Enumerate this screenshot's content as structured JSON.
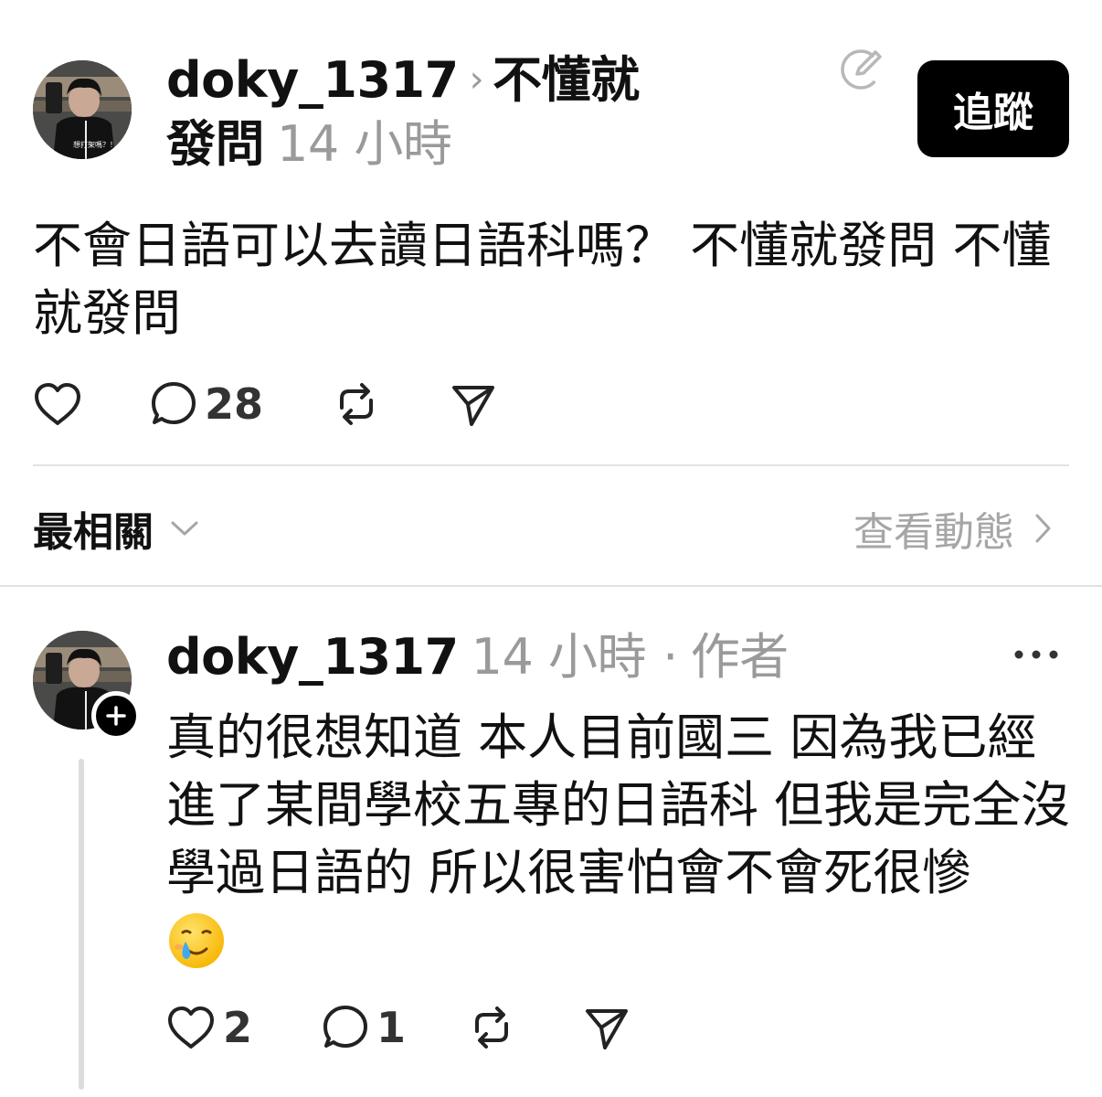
{
  "post": {
    "username": "doky_1317",
    "community_tag": "不懂就發問",
    "time_ago": "14 小時",
    "follow_label": "追蹤",
    "avatar_caption": "想打架嗎？！",
    "body": "不會日語可以去讀日語科嗎？ 不懂就發問 不懂就發問",
    "reply_count": "28"
  },
  "sort": {
    "label": "最相關",
    "view_activity": "查看動態"
  },
  "reply": {
    "username": "doky_1317",
    "time_ago": "14 小時",
    "separator": "·",
    "author_badge": "作者",
    "body": "真的很想知道 本人目前國三 因為我已經進了某間學校五專的日語科 但我是完全沒學過日語的 所以很害怕會不會死很慘",
    "emoji": "smiling-face-with-tear",
    "like_count": "2",
    "reply_count": "1"
  },
  "icons": {
    "heart": "heart-icon",
    "comment": "comment-icon",
    "repost": "repost-icon",
    "share": "send-icon",
    "edit": "edit-icon",
    "more": "more-icon",
    "chevron": "chevron-icon",
    "plus": "plus-icon"
  }
}
